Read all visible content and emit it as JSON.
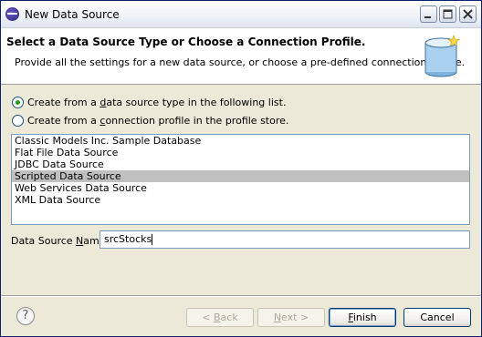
{
  "window": {
    "title": "New Data Source"
  },
  "header": {
    "title": "Select a Data Source Type or Choose a Connection Profile.",
    "description": "Provide all the settings for a new data source, or choose a pre-defined connection profile.",
    "icon": "database-icon"
  },
  "options": [
    {
      "label_pre": "Create from a ",
      "mnemonic": "d",
      "label_post": "ata source type in the following list.",
      "checked": true
    },
    {
      "label_pre": "Create from a ",
      "mnemonic": "c",
      "label_post": "onnection profile in the profile store.",
      "checked": false
    }
  ],
  "data_source_types": [
    "Classic Models Inc. Sample Database",
    "Flat File Data Source",
    "JDBC Data Source",
    "Scripted Data Source",
    "Web Services Data Source",
    "XML Data Source"
  ],
  "selected_type": "Scripted Data Source",
  "name_field": {
    "label_pre": "Data Source ",
    "mnemonic": "N",
    "label_post": "ame:",
    "value": "srcStocks"
  },
  "buttons": {
    "back_pre": "< ",
    "back_mnemonic": "B",
    "back_post": "ack",
    "next_mnemonic": "N",
    "next_post": "ext >",
    "finish_mnemonic": "F",
    "finish_post": "inish",
    "cancel_label": "Cancel"
  },
  "help_glyph": "?",
  "colors": {
    "title_border": "#0a246a",
    "selection": "#c0c0c0",
    "radio_dot": "#21a121"
  }
}
